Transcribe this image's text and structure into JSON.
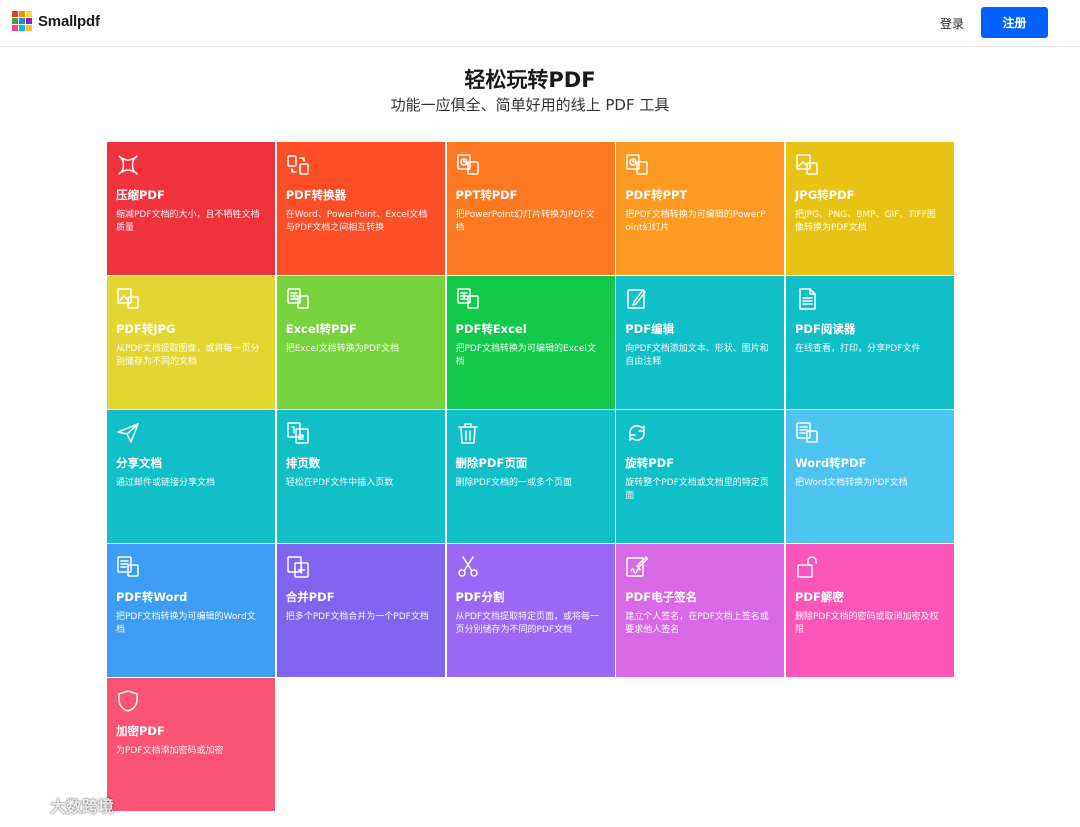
{
  "header": {
    "brand": "Smallpdf",
    "login_label": "登录",
    "signup_label": "注册",
    "logo_colors": [
      "#e53935",
      "#fb8c00",
      "#fdd835",
      "#43a047",
      "#1e88e5",
      "#8e24aa",
      "#ff4081",
      "#00bcd4",
      "#fbc02d"
    ]
  },
  "hero": {
    "title": "轻松玩转PDF",
    "subtitle": "功能一应俱全、简单好用的线上 PDF 工具"
  },
  "tools": [
    {
      "title": "压缩PDF",
      "desc": "缩减PDF文档的大小，且不牺牲文档质量",
      "color": "#f0323b",
      "icon": "compress-icon"
    },
    {
      "title": "PDF转换器",
      "desc": "在Word、PowerPoint、Excel文档与PDF文档之间相互转换",
      "color": "#fd4e28",
      "icon": "convert-icon"
    },
    {
      "title": "PPT转PDF",
      "desc": "把PowerPoint幻灯片转换为PDF文档",
      "color": "#fe7721",
      "icon": "ppt-icon"
    },
    {
      "title": "PDF转PPT",
      "desc": "把PDF文档转换为可编辑的PowerPoint幻灯片",
      "color": "#fe9a21",
      "icon": "ppt-icon"
    },
    {
      "title": "JPG转PDF",
      "desc": "把JPG、PNG、BMP、GIF、TIFF图像转换为PDF文档",
      "color": "#e8c214",
      "icon": "image-icon"
    },
    {
      "title": "PDF转JPG",
      "desc": "从PDF文档提取图像，或将每一页分别储存为不同的文档",
      "color": "#e2d732",
      "icon": "image-icon"
    },
    {
      "title": "Excel转PDF",
      "desc": "把Excel文档转换为PDF文档",
      "color": "#76d33d",
      "icon": "excel-icon"
    },
    {
      "title": "PDF转Excel",
      "desc": "把PDF文档转换为可编辑的Excel文档",
      "color": "#13c94a",
      "icon": "excel-icon"
    },
    {
      "title": "PDF编辑",
      "desc": "向PDF文档添加文本、形状、图片和自由注释",
      "color": "#10bfc7",
      "icon": "edit-icon"
    },
    {
      "title": "PDF阅读器",
      "desc": "在线查看，打印，分享PDF文件",
      "color": "#10bfc7",
      "icon": "reader-icon"
    },
    {
      "title": "分享文档",
      "desc": "通过邮件或链接分享文档",
      "color": "#10bfc7",
      "icon": "send-icon"
    },
    {
      "title": "排页数",
      "desc": "轻松在PDF文件中插入页数",
      "color": "#10bfc7",
      "icon": "numbers-icon"
    },
    {
      "title": "删除PDF页面",
      "desc": "删除PDF文档的一或多个页面",
      "color": "#10bfc7",
      "icon": "trash-icon"
    },
    {
      "title": "旋转PDF",
      "desc": "旋转整个PDF文档或文档里的特定页面",
      "color": "#10bfc7",
      "icon": "rotate-icon"
    },
    {
      "title": "Word转PDF",
      "desc": "把Word文档转换为PDF文档",
      "color": "#4dc4ef",
      "icon": "word-icon"
    },
    {
      "title": "PDF转Word",
      "desc": "把PDF文档转换为可编辑的Word文档",
      "color": "#3d9cf4",
      "icon": "word-icon"
    },
    {
      "title": "合并PDF",
      "desc": "把多个PDF文档合并为一个PDF文档",
      "color": "#8064ef",
      "icon": "merge-icon"
    },
    {
      "title": "PDF分割",
      "desc": "从PDF文档提取特定页面，或将每一页分别储存为不同的PDF文档",
      "color": "#9a68f5",
      "icon": "scissors-icon"
    },
    {
      "title": "PDF电子签名",
      "desc": "建立个人签名，在PDF文档上签名或要求他人签名",
      "color": "#d868e6",
      "icon": "sign-icon"
    },
    {
      "title": "PDF解密",
      "desc": "删除PDF文档的密码或取消加密及权限",
      "color": "#fb55b8",
      "icon": "unlock-icon"
    },
    {
      "title": "加密PDF",
      "desc": "为PDF文档添加密码或加密",
      "color": "#fb5373",
      "icon": "shield-icon"
    }
  ],
  "watermark": {
    "text": "大数跨境"
  }
}
